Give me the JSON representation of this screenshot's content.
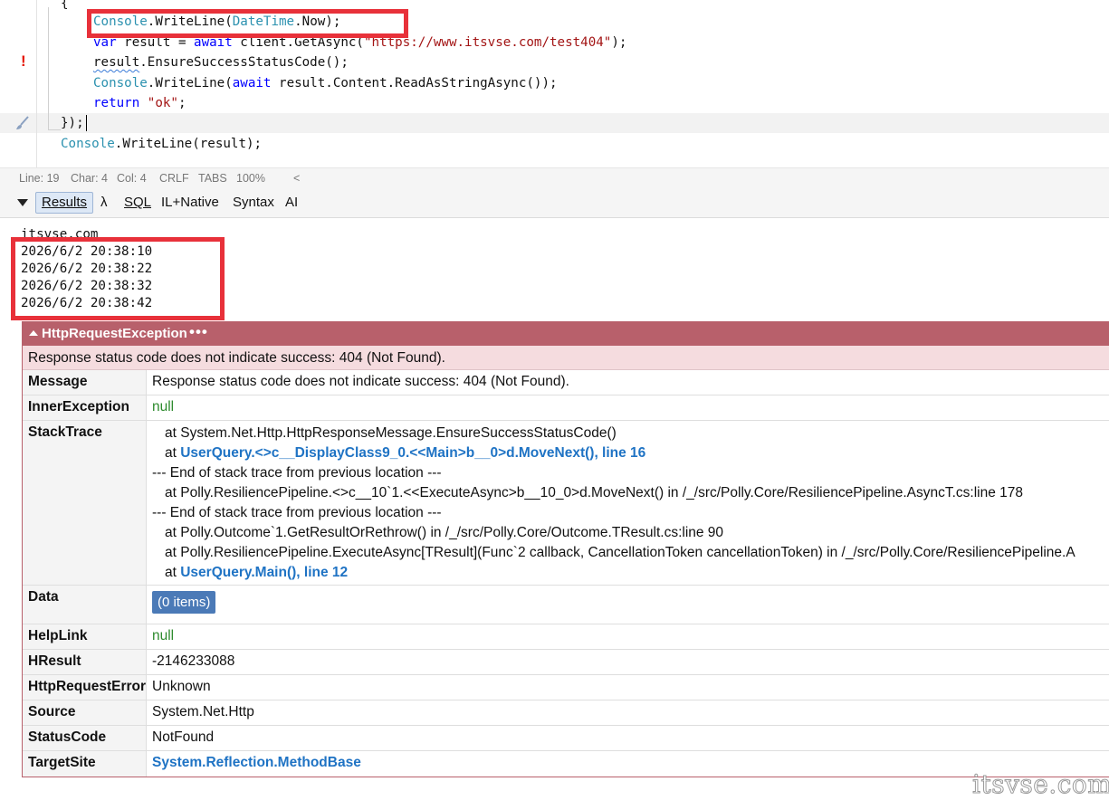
{
  "editor": {
    "lines": [
      [
        {
          "t": "{",
          "c": "pl"
        }
      ],
      [
        {
          "t": "Console",
          "c": "tp"
        },
        {
          "t": ".WriteLine(",
          "c": "pl"
        },
        {
          "t": "DateTime",
          "c": "tp"
        },
        {
          "t": ".Now);",
          "c": "pl"
        }
      ],
      [
        {
          "t": "var",
          "c": "kw"
        },
        {
          "t": " result = ",
          "c": "pl"
        },
        {
          "t": "await",
          "c": "kw"
        },
        {
          "t": " client.GetAsync(",
          "c": "pl"
        },
        {
          "t": "\"https://www.itsvse.com/test404\"",
          "c": "st"
        },
        {
          "t": ");",
          "c": "pl"
        }
      ],
      [
        {
          "t": "result",
          "c": "pl squiggle"
        },
        {
          "t": ".EnsureSuccessStatusCode();",
          "c": "pl"
        }
      ],
      [
        {
          "t": "Console",
          "c": "tp"
        },
        {
          "t": ".WriteLine(",
          "c": "pl"
        },
        {
          "t": "await",
          "c": "kw"
        },
        {
          "t": " result.Content.ReadAsStringAsync());",
          "c": "pl"
        }
      ],
      [
        {
          "t": "return",
          "c": "kw"
        },
        {
          "t": " ",
          "c": "pl"
        },
        {
          "t": "\"ok\"",
          "c": "st"
        },
        {
          "t": ";",
          "c": "pl"
        }
      ],
      [
        {
          "t": "});",
          "c": "pl"
        }
      ],
      [
        {
          "t": "Console",
          "c": "tp"
        },
        {
          "t": ".WriteLine(result);",
          "c": "pl"
        }
      ]
    ],
    "error_marker": "!"
  },
  "status_bar": {
    "line": "Line: 19",
    "char": "Char: 4",
    "col": "Col: 4",
    "eol": "CRLF",
    "indent": "TABS",
    "zoom": "100%",
    "arrow": "<"
  },
  "results_tabs": {
    "results": "Results",
    "lambda": "λ",
    "sql": "SQL",
    "il": "IL+Native",
    "syntax": "Syntax",
    "ai": "AI"
  },
  "output": {
    "partial_line": "itsvse.com",
    "timestamps": [
      "2026/6/2 20:38:10",
      "2026/6/2 20:38:22",
      "2026/6/2 20:38:32",
      "2026/6/2 20:38:42"
    ]
  },
  "exception": {
    "type": "HttpRequestException",
    "more": "•••",
    "summary": "Response status code does not indicate success: 404 (Not Found).",
    "message_label": "Message",
    "message": "Response status code does not indicate success: 404 (Not Found).",
    "inner_label": "InnerException",
    "inner": "null",
    "stack_label": "StackTrace",
    "stack": {
      "l1": "at System.Net.Http.HttpResponseMessage.EnsureSuccessStatusCode()",
      "l2_prefix": "at ",
      "l2_link": "UserQuery.<>c__DisplayClass9_0.<<Main>b__0>d.MoveNext(), line 16",
      "l3": "--- End of stack trace from previous location ---",
      "l4": "at Polly.ResiliencePipeline.<>c__10`1.<<ExecuteAsync>b__10_0>d.MoveNext() in /_/src/Polly.Core/ResiliencePipeline.AsyncT.cs:line 178",
      "l5": "--- End of stack trace from previous location ---",
      "l6": "at Polly.Outcome`1.GetResultOrRethrow() in /_/src/Polly.Core/Outcome.TResult.cs:line 90",
      "l7": "at Polly.ResiliencePipeline.ExecuteAsync[TResult](Func`2 callback, CancellationToken cancellationToken) in /_/src/Polly.Core/ResiliencePipeline.A",
      "l8_prefix": "at ",
      "l8_link": "UserQuery.Main(), line 12"
    },
    "data_label": "Data",
    "data_button": "(0 items)",
    "helplink_label": "HelpLink",
    "helplink": "null",
    "hresult_label": "HResult",
    "hresult": "-2146233088",
    "httperror_label": "HttpRequestError",
    "httperror": "Unknown",
    "source_label": "Source",
    "source": "System.Net.Http",
    "statuscode_label": "StatusCode",
    "statuscode": "NotFound",
    "targetsite_label": "TargetSite",
    "targetsite": "System.Reflection.MethodBase"
  },
  "watermark": "itsvse.com",
  "colors": {
    "annotation": "#e8313a",
    "exception_header": "#b8606b",
    "keyword": "#0000ff",
    "type": "#2b91af",
    "string": "#a31515",
    "link": "#1f73c4"
  }
}
